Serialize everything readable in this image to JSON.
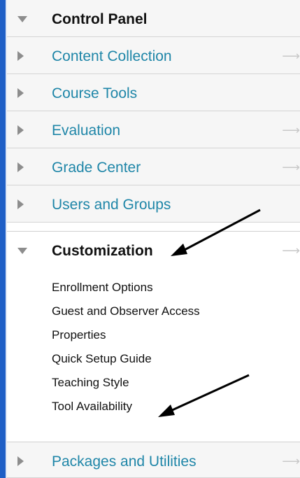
{
  "panel": {
    "title": "Control Panel",
    "items": [
      {
        "label": "Content Collection"
      },
      {
        "label": "Course Tools"
      },
      {
        "label": "Evaluation"
      },
      {
        "label": "Grade Center"
      },
      {
        "label": "Users and Groups"
      }
    ],
    "expanded": {
      "label": "Customization",
      "subitems": [
        {
          "label": "Enrollment Options"
        },
        {
          "label": "Guest and Observer Access"
        },
        {
          "label": "Properties"
        },
        {
          "label": "Quick Setup Guide"
        },
        {
          "label": "Teaching Style"
        },
        {
          "label": "Tool Availability"
        }
      ]
    },
    "last_item": {
      "label": "Packages and Utilities"
    }
  },
  "icons": {
    "expand": "triangle-right-icon",
    "collapse": "triangle-down-icon",
    "go": "right-arrow-icon"
  },
  "colors": {
    "link": "#1f86a8",
    "accent_bar": "#1f5fc6",
    "annotation_arrow": "#000000"
  }
}
